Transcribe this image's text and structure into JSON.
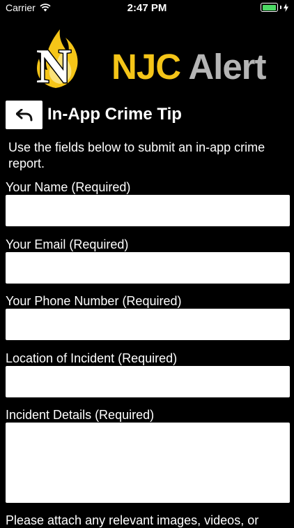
{
  "status_bar": {
    "carrier": "Carrier",
    "time": "2:47 PM"
  },
  "logo": {
    "brand": "NJC",
    "product": "Alert",
    "emblem_letter": "N",
    "colors": {
      "gold": "#f5c518",
      "gray": "#b5b5b5"
    }
  },
  "header": {
    "title": "In-App Crime Tip",
    "back_icon": "back-arrow-icon"
  },
  "intro": "Use the fields below to submit an in-app crime report.",
  "form": {
    "name_label": "Your Name (Required)",
    "name_value": "",
    "email_label": "Your Email (Required)",
    "email_value": "",
    "phone_label": "Your Phone Number (Required)",
    "phone_value": "",
    "location_label": "Location of Incident (Required)",
    "location_value": "",
    "details_label": "Incident Details (Required)",
    "details_value": ""
  },
  "attach_text": "Please attach any relevant images, videos, or"
}
